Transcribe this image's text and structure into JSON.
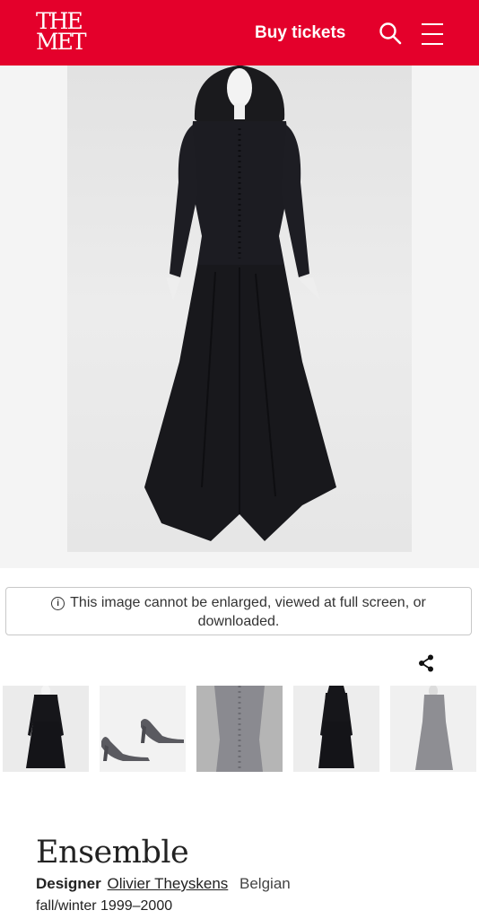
{
  "header": {
    "logo_line1": "THE",
    "logo_line2": "MET",
    "buy_label": "Buy tickets",
    "background": "#e4002b"
  },
  "icons": {
    "search": "search-icon",
    "menu": "hamburger-menu-icon",
    "info": "info-icon",
    "share": "share-icon"
  },
  "notice": {
    "info_glyph": "i",
    "text_line1": "This image cannot be enlarged, viewed at full screen, or",
    "text_line2": "downloaded."
  },
  "object": {
    "title": "Ensemble",
    "designer_label": "Designer",
    "designer_name": "Olivier Theyskens",
    "nationality": "Belgian",
    "date": "fall/winter 1999–2000"
  },
  "thumbnails": [
    "front-view",
    "shoes",
    "back-detail",
    "front-view-alt",
    "side-view"
  ]
}
